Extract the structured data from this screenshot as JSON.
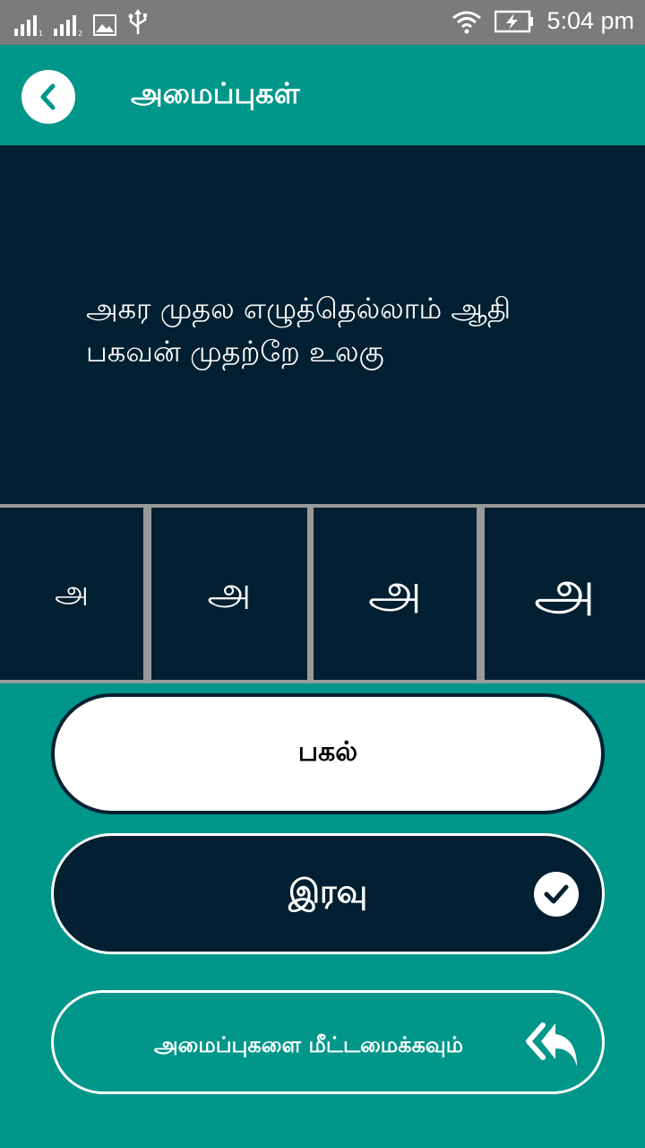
{
  "status_bar": {
    "time": "5:04 pm",
    "icons": [
      "signal-1-icon",
      "signal-2-icon",
      "image-icon",
      "usb-icon",
      "wifi-icon",
      "battery-charging-icon"
    ]
  },
  "app_bar": {
    "title": "அமைப்புகள்",
    "back_icon": "chevron-left-icon"
  },
  "preview": {
    "text": "அகர முதல எழுத்தெல்லாம் ஆதி பகவன் முதற்றே உலகு"
  },
  "font_sizes": {
    "glyph": "அ",
    "options": [
      "small",
      "medium",
      "large",
      "extra-large"
    ]
  },
  "theme": {
    "day_label": "பகல்",
    "night_label": "இரவு",
    "selected": "night"
  },
  "reset": {
    "label": "அமைப்புகளை மீட்டமைக்கவும்",
    "icon": "reply-all-icon"
  },
  "colors": {
    "teal": "#00968a",
    "navy": "#022031",
    "status_bar": "#7b7b7b"
  }
}
